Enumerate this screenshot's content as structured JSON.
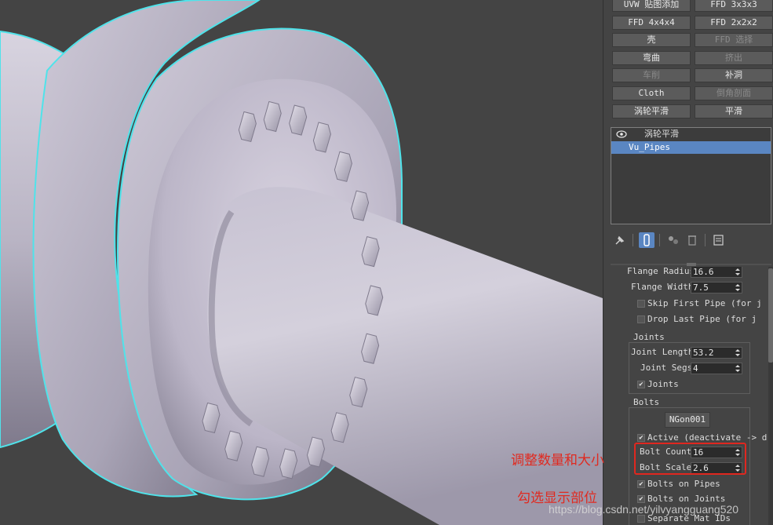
{
  "colors": {
    "viewport_bg": "#444444",
    "mesh": "#bdb8c6",
    "selection_outline": "#4fe3ea",
    "stack_selected": "#5a86c2",
    "annotation_red": "#e0271f"
  },
  "modifier_buttons": [
    {
      "label": "UVW 贴图添加",
      "enabled": true
    },
    {
      "label": "FFD 3x3x3",
      "enabled": true
    },
    {
      "label": "FFD 4x4x4",
      "enabled": true
    },
    {
      "label": "FFD 2x2x2",
      "enabled": true
    },
    {
      "label": "壳",
      "enabled": true
    },
    {
      "label": "FFD 选择",
      "enabled": false
    },
    {
      "label": "弯曲",
      "enabled": true
    },
    {
      "label": "挤出",
      "enabled": false
    },
    {
      "label": "车削",
      "enabled": false
    },
    {
      "label": "补洞",
      "enabled": true
    },
    {
      "label": "Cloth",
      "enabled": true
    },
    {
      "label": "倒角剖面",
      "enabled": false
    },
    {
      "label": "涡轮平滑",
      "enabled": true
    },
    {
      "label": "平滑",
      "enabled": true
    }
  ],
  "modifier_stack": {
    "items": [
      {
        "label": "涡轮平滑",
        "icon": "eye-icon",
        "selected": false
      },
      {
        "label": "Vu_Pipes",
        "selected": true
      }
    ]
  },
  "stack_toolbar": {
    "icons": [
      "pin-stack-icon",
      "show-end-result-icon",
      "make-unique-icon",
      "remove-modifier-icon",
      "configure-sets-icon"
    ]
  },
  "params": {
    "flange_radius": {
      "label": "Flange Radius",
      "value": "16.6"
    },
    "flange_width": {
      "label": "Flange Width",
      "value": "7.5"
    },
    "skip_first_pipe": {
      "label": "Skip First Pipe (for j",
      "checked": false
    },
    "drop_last_pipe": {
      "label": "Drop Last Pipe (for j",
      "checked": false
    }
  },
  "joints": {
    "group_title": "Joints",
    "joint_length": {
      "label": "Joint Length",
      "value": "53.2"
    },
    "joint_segs": {
      "label": "Joint Segs",
      "value": "4"
    },
    "joints_check": {
      "label": "Joints",
      "checked": true
    }
  },
  "bolts": {
    "group_title": "Bolts",
    "ngon_button": "NGon001",
    "active": {
      "label": "Active (deactivate -> d",
      "checked": true
    },
    "bolt_count": {
      "label": "Bolt Count",
      "value": "16"
    },
    "bolt_scale": {
      "label": "Bolt Scale",
      "value": "2.6"
    },
    "bolts_on_pipes": {
      "label": "Bolts on Pipes",
      "checked": true
    },
    "bolts_on_joints": {
      "label": "Bolts on Joints",
      "checked": true
    },
    "separate_mat_ids": {
      "label": "Separate Mat IDs",
      "checked": false
    }
  },
  "annotations": {
    "adjust": "调整数量和大小",
    "check_display": "勾选显示部位"
  },
  "watermark": "https://blog.csdn.net/yilvyangguang520"
}
